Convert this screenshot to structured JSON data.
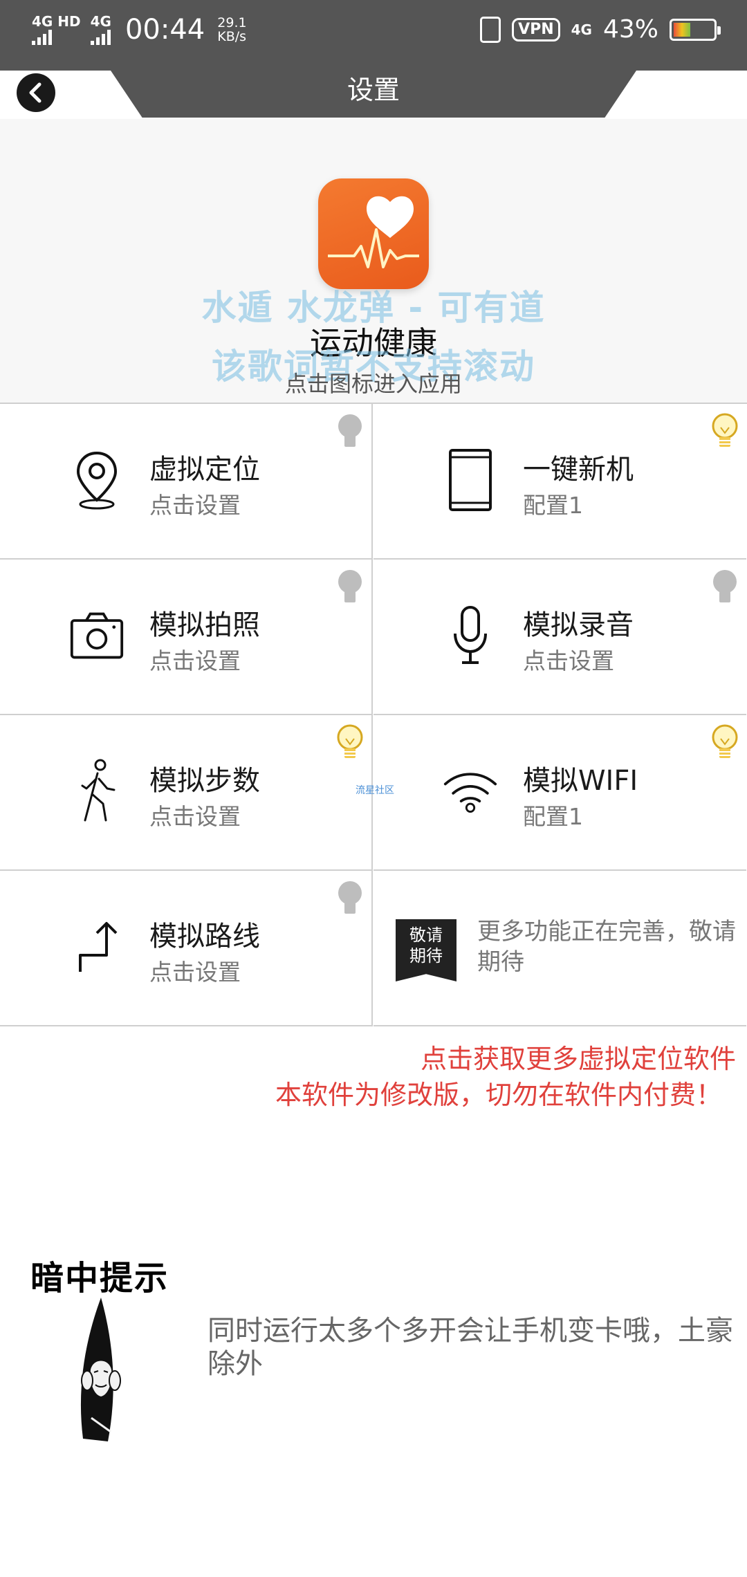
{
  "status_bar": {
    "signal1": "4G HD",
    "signal2": "4G",
    "time": "00:44",
    "speed_value": "29.1",
    "speed_unit": "KB/s",
    "vpn": "VPN",
    "net": "4G",
    "battery": "43%",
    "battery_level": 0.43
  },
  "header": {
    "title": "设置",
    "back_icon": "back-arrow-icon"
  },
  "app": {
    "name": "运动健康",
    "hint": "点击图标进入应用",
    "icon": "heart-pulse-icon",
    "icon_color": "#ef6a25",
    "watermark_line1": "水遁 水龙弹 - 可有道",
    "watermark_line2": "该歌词暂不支持滚动"
  },
  "features": [
    {
      "title": "虚拟定位",
      "sub": "点击设置",
      "icon": "location-pin-icon",
      "bulb": "off"
    },
    {
      "title": "一键新机",
      "sub": "配置1",
      "icon": "phone-outline-icon",
      "bulb": "on"
    },
    {
      "title": "模拟拍照",
      "sub": "点击设置",
      "icon": "camera-icon",
      "bulb": "off"
    },
    {
      "title": "模拟录音",
      "sub": "点击设置",
      "icon": "microphone-icon",
      "bulb": "off"
    },
    {
      "title": "模拟步数",
      "sub": "点击设置",
      "icon": "walking-person-icon",
      "bulb": "on"
    },
    {
      "title": "模拟WIFI",
      "sub": "配置1",
      "icon": "wifi-icon",
      "bulb": "on"
    },
    {
      "title": "模拟路线",
      "sub": "点击设置",
      "icon": "route-arrow-icon",
      "bulb": "off"
    }
  ],
  "coming_soon": {
    "badge_line1": "敬请",
    "badge_line2": "期待",
    "text": "更多功能正在完善，敬请期待"
  },
  "tiny_watermark": "流星社区",
  "links": {
    "more_software": "点击获取更多虚拟定位软件",
    "warning": "本软件为修改版，切勿在软件内付费！"
  },
  "tip": {
    "title": "暗中提示",
    "text": "同时运行太多个多开会让手机变卡哦，土豪除外"
  },
  "colors": {
    "status_bar_bg": "#555555",
    "red_text": "#e0413c",
    "bulb_on": "#f2c94c",
    "bulb_off": "#bdbdbd"
  }
}
